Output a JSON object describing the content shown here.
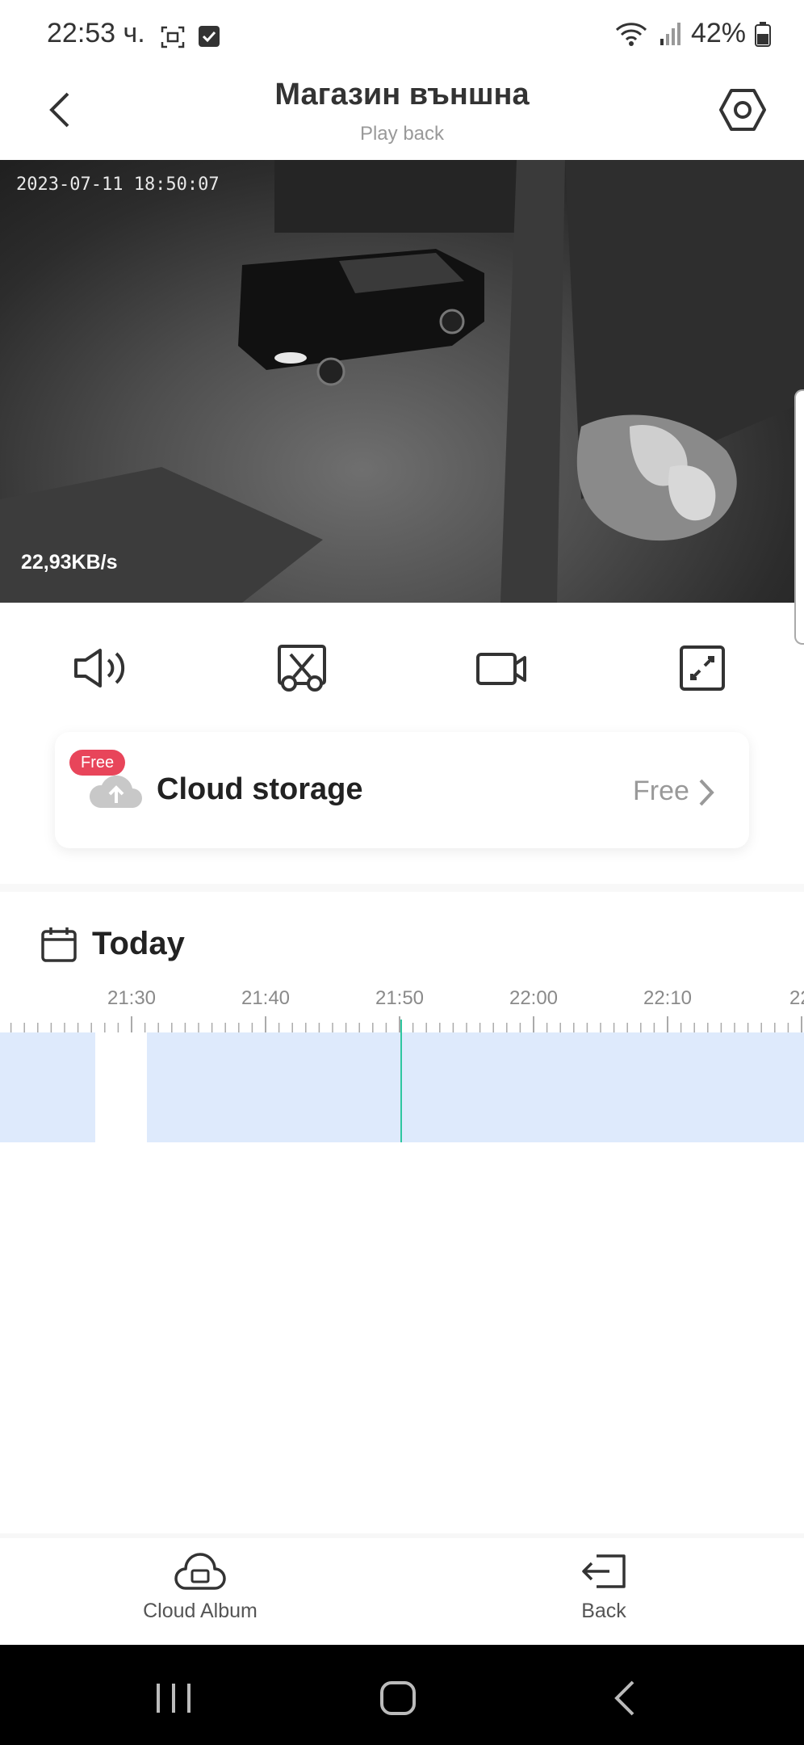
{
  "status_bar": {
    "time": "22:53 ч.",
    "battery": "42%",
    "icons": [
      "screenshot-icon",
      "checkbox-icon",
      "wifi-icon",
      "signal-icon",
      "battery-icon"
    ]
  },
  "header": {
    "title": "Магазин външна",
    "subtitle": "Play back",
    "back_icon": "chevron-left-icon",
    "settings_icon": "hexagon-settings-icon"
  },
  "video": {
    "timestamp": "2023-07-11 18:50:07",
    "data_rate": "22,93KB/s"
  },
  "controls": [
    "speaker-icon",
    "scissors-clip-icon",
    "video-record-icon",
    "fullscreen-icon"
  ],
  "cloud": {
    "badge": "Free",
    "title": "Cloud storage",
    "link": "Free",
    "badge_color": "#e8455a"
  },
  "today": {
    "label": "Today"
  },
  "timeline": {
    "labels": [
      "21:30",
      "21:40",
      "21:50",
      "22:00",
      "22:10",
      "22:"
    ],
    "recording_color": "#deeafc",
    "cursor_color": "#2fc7a0"
  },
  "bottom_bar": {
    "cloud_album": "Cloud Album",
    "back": "Back"
  },
  "system_nav": [
    "recents-icon",
    "home-icon",
    "back-icon"
  ]
}
